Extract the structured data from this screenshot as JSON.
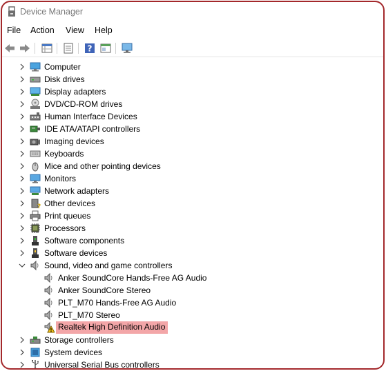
{
  "window": {
    "title": "Device Manager"
  },
  "menu": [
    "File",
    "Action",
    "View",
    "Help"
  ],
  "toolbar": {
    "buttons": [
      "back-icon",
      "forward-icon",
      "properties-grid-icon",
      "sheet-icon",
      "help-icon",
      "panel-icon",
      "scan-monitor-icon"
    ]
  },
  "tree": {
    "categories": [
      {
        "label": "Computer",
        "icon": "computer-icon",
        "expanded": false
      },
      {
        "label": "Disk drives",
        "icon": "disk-drive-icon",
        "expanded": false
      },
      {
        "label": "Display adapters",
        "icon": "display-adapter-icon",
        "expanded": false
      },
      {
        "label": "DVD/CD-ROM drives",
        "icon": "dvd-drive-icon",
        "expanded": false
      },
      {
        "label": "Human Interface Devices",
        "icon": "hid-icon",
        "expanded": false
      },
      {
        "label": "IDE ATA/ATAPI controllers",
        "icon": "ide-controller-icon",
        "expanded": false
      },
      {
        "label": "Imaging devices",
        "icon": "camera-icon",
        "expanded": false
      },
      {
        "label": "Keyboards",
        "icon": "keyboard-icon",
        "expanded": false
      },
      {
        "label": "Mice and other pointing devices",
        "icon": "mouse-icon",
        "expanded": false
      },
      {
        "label": "Monitors",
        "icon": "monitor-icon",
        "expanded": false
      },
      {
        "label": "Network adapters",
        "icon": "network-adapter-icon",
        "expanded": false
      },
      {
        "label": "Other devices",
        "icon": "other-device-icon",
        "expanded": false
      },
      {
        "label": "Print queues",
        "icon": "printer-icon",
        "expanded": false
      },
      {
        "label": "Processors",
        "icon": "processor-icon",
        "expanded": false
      },
      {
        "label": "Software components",
        "icon": "software-component-icon",
        "expanded": false
      },
      {
        "label": "Software devices",
        "icon": "software-device-icon",
        "expanded": false
      },
      {
        "label": "Sound, video and game controllers",
        "icon": "speaker-icon",
        "expanded": true,
        "children": [
          {
            "label": "Anker SoundCore Hands-Free AG Audio",
            "icon": "speaker-icon",
            "warning": false,
            "selected": false
          },
          {
            "label": "Anker SoundCore Stereo",
            "icon": "speaker-icon",
            "warning": false,
            "selected": false
          },
          {
            "label": "PLT_M70 Hands-Free AG Audio",
            "icon": "speaker-icon",
            "warning": false,
            "selected": false
          },
          {
            "label": "PLT_M70 Stereo",
            "icon": "speaker-icon",
            "warning": false,
            "selected": false
          },
          {
            "label": "Realtek High Definition Audio",
            "icon": "speaker-warning-icon",
            "warning": true,
            "selected": true
          }
        ]
      },
      {
        "label": "Storage controllers",
        "icon": "storage-controller-icon",
        "expanded": false
      },
      {
        "label": "System devices",
        "icon": "system-device-icon",
        "expanded": false
      },
      {
        "label": "Universal Serial Bus controllers",
        "icon": "usb-controller-icon",
        "expanded": false
      }
    ]
  },
  "colors": {
    "frame_border": "#a3282b",
    "selection": "#f3a6a8",
    "title_text": "#777777"
  }
}
